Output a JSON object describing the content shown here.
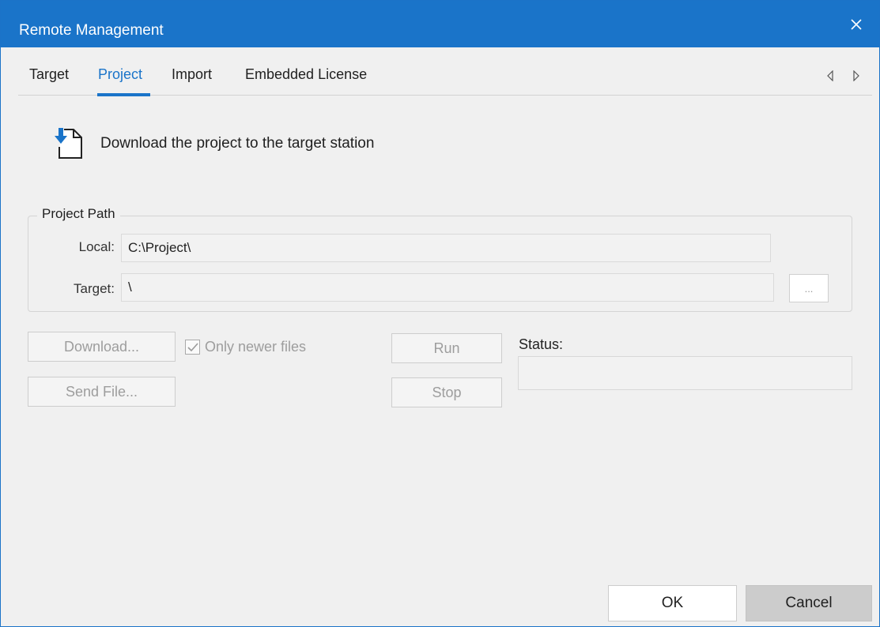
{
  "window": {
    "title": "Remote Management",
    "accent_color": "#1a74c9",
    "close_icon": "close-icon"
  },
  "tabs": {
    "items": [
      {
        "label": "Target",
        "active": false
      },
      {
        "label": "Project",
        "active": true
      },
      {
        "label": "Import",
        "active": false
      },
      {
        "label": "Embedded License",
        "active": false
      }
    ],
    "scroll_left_icon": "triangle-left-icon",
    "scroll_right_icon": "triangle-right-icon"
  },
  "header": {
    "icon": "download-file-icon",
    "text": "Download the project to the target station"
  },
  "project_path": {
    "legend": "Project Path",
    "local_label": "Local:",
    "local_value": "C:\\Project\\",
    "target_label": "Target:",
    "target_value": "\\",
    "browse_label": "..."
  },
  "actions": {
    "download_label": "Download...",
    "only_newer_label": "Only newer files",
    "only_newer_checked": true,
    "send_file_label": "Send File...",
    "run_label": "Run",
    "stop_label": "Stop",
    "status_label": "Status:",
    "status_value": ""
  },
  "footer": {
    "ok_label": "OK",
    "cancel_label": "Cancel"
  }
}
